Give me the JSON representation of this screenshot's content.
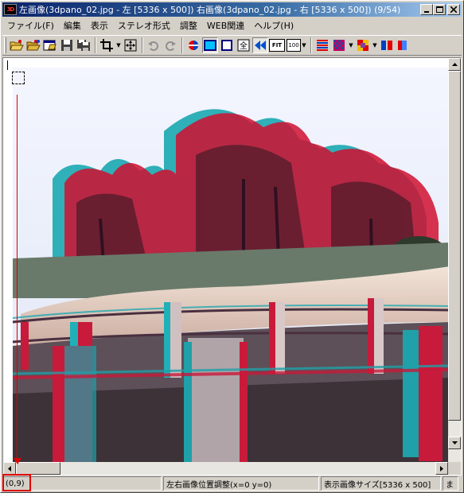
{
  "window": {
    "title": "左画像(3dpano_02.jpg - 左 [5336 x 500]) 右画像(3dpano_02.jpg - 右 [5336 x 500])  (9/54)",
    "app_icon_text": "3D"
  },
  "menu": {
    "items": [
      "ファイル(F)",
      "編集",
      "表示",
      "ステレオ形式",
      "調整",
      "WEB関連",
      "ヘルプ(H)"
    ]
  },
  "toolbar": {
    "fit_label": "FIT",
    "zoom_label": "100"
  },
  "status": {
    "coords": "(0,9)",
    "adjust": "左右画像位置調整(x=0 y=0)",
    "image_size": "表示画像サイズ[5336 x 500]",
    "overflow": "ま"
  },
  "colors": {
    "title_start": "#0a246a",
    "title_end": "#a6caf0",
    "accent_red": "#e00000"
  }
}
